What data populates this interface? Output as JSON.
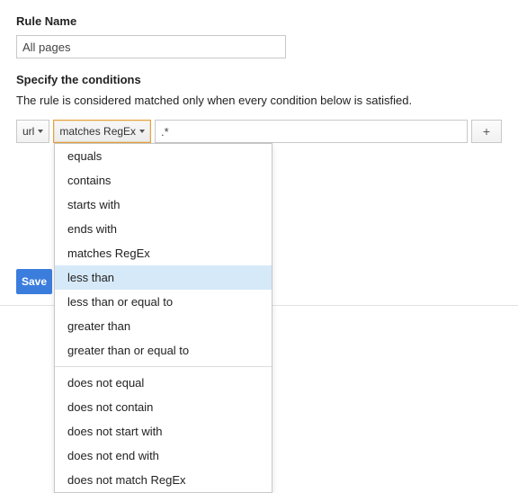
{
  "rule_name": {
    "label": "Rule Name",
    "value": "All pages"
  },
  "conditions": {
    "heading": "Specify the conditions",
    "description": "The rule is considered matched only when every condition below is satisfied.",
    "field_selector": {
      "selected": "url"
    },
    "operator_selector": {
      "selected": "matches RegEx",
      "highlighted": "less than",
      "group1": [
        "equals",
        "contains",
        "starts with",
        "ends with",
        "matches RegEx",
        "less than",
        "less than or equal to",
        "greater than",
        "greater than or equal to"
      ],
      "group2": [
        "does not equal",
        "does not contain",
        "does not start with",
        "does not end with",
        "does not match RegEx"
      ]
    },
    "pattern_value": ".*",
    "add_button": "+"
  },
  "footer": {
    "save": "Save"
  }
}
